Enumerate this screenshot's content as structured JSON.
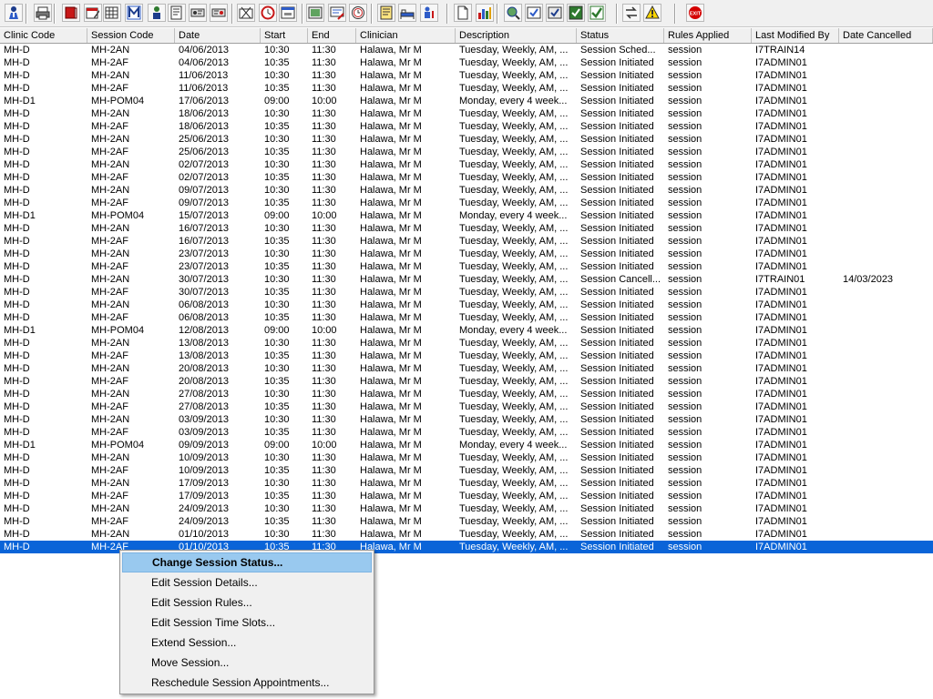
{
  "toolbar": {
    "buttons": [
      {
        "icon": "patient-icon"
      },
      {
        "icon": "printer-icon"
      },
      {
        "icon": "book-red-icon"
      },
      {
        "icon": "calendar-edit-icon"
      },
      {
        "icon": "grid-edit-icon"
      },
      {
        "icon": "m-letter-icon"
      },
      {
        "icon": "person-icon"
      },
      {
        "icon": "notes-icon"
      },
      {
        "icon": "ticket-icon"
      },
      {
        "icon": "ticket-alt-icon"
      },
      {
        "icon": "folder-cut-icon"
      },
      {
        "icon": "clock-icon"
      },
      {
        "icon": "window-icon"
      },
      {
        "icon": "picture-frame-icon"
      },
      {
        "icon": "card-edit-icon"
      },
      {
        "icon": "clock-face-icon"
      },
      {
        "icon": "note-pad-icon"
      },
      {
        "icon": "bed-icon"
      },
      {
        "icon": "person-chart-icon"
      },
      {
        "icon": "page-icon"
      },
      {
        "icon": "bar-chart-icon"
      },
      {
        "icon": "globe-search-icon"
      },
      {
        "icon": "check-window-icon"
      },
      {
        "icon": "check-window-alt-icon"
      },
      {
        "icon": "refresh-check-icon"
      },
      {
        "icon": "check-green-icon"
      },
      {
        "icon": "swap-arrows-icon"
      },
      {
        "icon": "warning-icon"
      },
      {
        "icon": "exit-icon"
      }
    ],
    "exit_label": "EXIT"
  },
  "table": {
    "headers": [
      "Clinic Code",
      "Session Code",
      "Date",
      "Start",
      "End",
      "Clinician",
      "Description",
      "Status",
      "Rules Applied",
      "Last Modified By",
      "Date Cancelled"
    ],
    "rows": [
      [
        "MH-D",
        "MH-2AN",
        "04/06/2013",
        "10:30",
        "11:30",
        "Halawa, Mr M",
        "Tuesday, Weekly, AM, ...",
        "Session Sched...",
        "session",
        "I7TRAIN14",
        ""
      ],
      [
        "MH-D",
        "MH-2AF",
        "04/06/2013",
        "10:35",
        "11:30",
        "Halawa, Mr M",
        "Tuesday, Weekly, AM, ...",
        "Session Initiated",
        "session",
        "I7ADMIN01",
        ""
      ],
      [
        "MH-D",
        "MH-2AN",
        "11/06/2013",
        "10:30",
        "11:30",
        "Halawa, Mr M",
        "Tuesday, Weekly, AM, ...",
        "Session Initiated",
        "session",
        "I7ADMIN01",
        ""
      ],
      [
        "MH-D",
        "MH-2AF",
        "11/06/2013",
        "10:35",
        "11:30",
        "Halawa, Mr M",
        "Tuesday, Weekly, AM, ...",
        "Session Initiated",
        "session",
        "I7ADMIN01",
        ""
      ],
      [
        "MH-D1",
        "MH-POM04",
        "17/06/2013",
        "09:00",
        "10:00",
        "Halawa, Mr M",
        "Monday, every 4 week...",
        "Session Initiated",
        "session",
        "I7ADMIN01",
        ""
      ],
      [
        "MH-D",
        "MH-2AN",
        "18/06/2013",
        "10:30",
        "11:30",
        "Halawa, Mr M",
        "Tuesday, Weekly, AM, ...",
        "Session Initiated",
        "session",
        "I7ADMIN01",
        ""
      ],
      [
        "MH-D",
        "MH-2AF",
        "18/06/2013",
        "10:35",
        "11:30",
        "Halawa, Mr M",
        "Tuesday, Weekly, AM, ...",
        "Session Initiated",
        "session",
        "I7ADMIN01",
        ""
      ],
      [
        "MH-D",
        "MH-2AN",
        "25/06/2013",
        "10:30",
        "11:30",
        "Halawa, Mr M",
        "Tuesday, Weekly, AM, ...",
        "Session Initiated",
        "session",
        "I7ADMIN01",
        ""
      ],
      [
        "MH-D",
        "MH-2AF",
        "25/06/2013",
        "10:35",
        "11:30",
        "Halawa, Mr M",
        "Tuesday, Weekly, AM, ...",
        "Session Initiated",
        "session",
        "I7ADMIN01",
        ""
      ],
      [
        "MH-D",
        "MH-2AN",
        "02/07/2013",
        "10:30",
        "11:30",
        "Halawa, Mr M",
        "Tuesday, Weekly, AM, ...",
        "Session Initiated",
        "session",
        "I7ADMIN01",
        ""
      ],
      [
        "MH-D",
        "MH-2AF",
        "02/07/2013",
        "10:35",
        "11:30",
        "Halawa, Mr M",
        "Tuesday, Weekly, AM, ...",
        "Session Initiated",
        "session",
        "I7ADMIN01",
        ""
      ],
      [
        "MH-D",
        "MH-2AN",
        "09/07/2013",
        "10:30",
        "11:30",
        "Halawa, Mr M",
        "Tuesday, Weekly, AM, ...",
        "Session Initiated",
        "session",
        "I7ADMIN01",
        ""
      ],
      [
        "MH-D",
        "MH-2AF",
        "09/07/2013",
        "10:35",
        "11:30",
        "Halawa, Mr M",
        "Tuesday, Weekly, AM, ...",
        "Session Initiated",
        "session",
        "I7ADMIN01",
        ""
      ],
      [
        "MH-D1",
        "MH-POM04",
        "15/07/2013",
        "09:00",
        "10:00",
        "Halawa, Mr M",
        "Monday, every 4 week...",
        "Session Initiated",
        "session",
        "I7ADMIN01",
        ""
      ],
      [
        "MH-D",
        "MH-2AN",
        "16/07/2013",
        "10:30",
        "11:30",
        "Halawa, Mr M",
        "Tuesday, Weekly, AM, ...",
        "Session Initiated",
        "session",
        "I7ADMIN01",
        ""
      ],
      [
        "MH-D",
        "MH-2AF",
        "16/07/2013",
        "10:35",
        "11:30",
        "Halawa, Mr M",
        "Tuesday, Weekly, AM, ...",
        "Session Initiated",
        "session",
        "I7ADMIN01",
        ""
      ],
      [
        "MH-D",
        "MH-2AN",
        "23/07/2013",
        "10:30",
        "11:30",
        "Halawa, Mr M",
        "Tuesday, Weekly, AM, ...",
        "Session Initiated",
        "session",
        "I7ADMIN01",
        ""
      ],
      [
        "MH-D",
        "MH-2AF",
        "23/07/2013",
        "10:35",
        "11:30",
        "Halawa, Mr M",
        "Tuesday, Weekly, AM, ...",
        "Session Initiated",
        "session",
        "I7ADMIN01",
        ""
      ],
      [
        "MH-D",
        "MH-2AN",
        "30/07/2013",
        "10:30",
        "11:30",
        "Halawa, Mr M",
        "Tuesday, Weekly, AM, ...",
        "Session Cancell...",
        "session",
        "I7TRAIN01",
        "14/03/2023"
      ],
      [
        "MH-D",
        "MH-2AF",
        "30/07/2013",
        "10:35",
        "11:30",
        "Halawa, Mr M",
        "Tuesday, Weekly, AM, ...",
        "Session Initiated",
        "session",
        "I7ADMIN01",
        ""
      ],
      [
        "MH-D",
        "MH-2AN",
        "06/08/2013",
        "10:30",
        "11:30",
        "Halawa, Mr M",
        "Tuesday, Weekly, AM, ...",
        "Session Initiated",
        "session",
        "I7ADMIN01",
        ""
      ],
      [
        "MH-D",
        "MH-2AF",
        "06/08/2013",
        "10:35",
        "11:30",
        "Halawa, Mr M",
        "Tuesday, Weekly, AM, ...",
        "Session Initiated",
        "session",
        "I7ADMIN01",
        ""
      ],
      [
        "MH-D1",
        "MH-POM04",
        "12/08/2013",
        "09:00",
        "10:00",
        "Halawa, Mr M",
        "Monday, every 4 week...",
        "Session Initiated",
        "session",
        "I7ADMIN01",
        ""
      ],
      [
        "MH-D",
        "MH-2AN",
        "13/08/2013",
        "10:30",
        "11:30",
        "Halawa, Mr M",
        "Tuesday, Weekly, AM, ...",
        "Session Initiated",
        "session",
        "I7ADMIN01",
        ""
      ],
      [
        "MH-D",
        "MH-2AF",
        "13/08/2013",
        "10:35",
        "11:30",
        "Halawa, Mr M",
        "Tuesday, Weekly, AM, ...",
        "Session Initiated",
        "session",
        "I7ADMIN01",
        ""
      ],
      [
        "MH-D",
        "MH-2AN",
        "20/08/2013",
        "10:30",
        "11:30",
        "Halawa, Mr M",
        "Tuesday, Weekly, AM, ...",
        "Session Initiated",
        "session",
        "I7ADMIN01",
        ""
      ],
      [
        "MH-D",
        "MH-2AF",
        "20/08/2013",
        "10:35",
        "11:30",
        "Halawa, Mr M",
        "Tuesday, Weekly, AM, ...",
        "Session Initiated",
        "session",
        "I7ADMIN01",
        ""
      ],
      [
        "MH-D",
        "MH-2AN",
        "27/08/2013",
        "10:30",
        "11:30",
        "Halawa, Mr M",
        "Tuesday, Weekly, AM, ...",
        "Session Initiated",
        "session",
        "I7ADMIN01",
        ""
      ],
      [
        "MH-D",
        "MH-2AF",
        "27/08/2013",
        "10:35",
        "11:30",
        "Halawa, Mr M",
        "Tuesday, Weekly, AM, ...",
        "Session Initiated",
        "session",
        "I7ADMIN01",
        ""
      ],
      [
        "MH-D",
        "MH-2AN",
        "03/09/2013",
        "10:30",
        "11:30",
        "Halawa, Mr M",
        "Tuesday, Weekly, AM, ...",
        "Session Initiated",
        "session",
        "I7ADMIN01",
        ""
      ],
      [
        "MH-D",
        "MH-2AF",
        "03/09/2013",
        "10:35",
        "11:30",
        "Halawa, Mr M",
        "Tuesday, Weekly, AM, ...",
        "Session Initiated",
        "session",
        "I7ADMIN01",
        ""
      ],
      [
        "MH-D1",
        "MH-POM04",
        "09/09/2013",
        "09:00",
        "10:00",
        "Halawa, Mr M",
        "Monday, every 4 week...",
        "Session Initiated",
        "session",
        "I7ADMIN01",
        ""
      ],
      [
        "MH-D",
        "MH-2AN",
        "10/09/2013",
        "10:30",
        "11:30",
        "Halawa, Mr M",
        "Tuesday, Weekly, AM, ...",
        "Session Initiated",
        "session",
        "I7ADMIN01",
        ""
      ],
      [
        "MH-D",
        "MH-2AF",
        "10/09/2013",
        "10:35",
        "11:30",
        "Halawa, Mr M",
        "Tuesday, Weekly, AM, ...",
        "Session Initiated",
        "session",
        "I7ADMIN01",
        ""
      ],
      [
        "MH-D",
        "MH-2AN",
        "17/09/2013",
        "10:30",
        "11:30",
        "Halawa, Mr M",
        "Tuesday, Weekly, AM, ...",
        "Session Initiated",
        "session",
        "I7ADMIN01",
        ""
      ],
      [
        "MH-D",
        "MH-2AF",
        "17/09/2013",
        "10:35",
        "11:30",
        "Halawa, Mr M",
        "Tuesday, Weekly, AM, ...",
        "Session Initiated",
        "session",
        "I7ADMIN01",
        ""
      ],
      [
        "MH-D",
        "MH-2AN",
        "24/09/2013",
        "10:30",
        "11:30",
        "Halawa, Mr M",
        "Tuesday, Weekly, AM, ...",
        "Session Initiated",
        "session",
        "I7ADMIN01",
        ""
      ],
      [
        "MH-D",
        "MH-2AF",
        "24/09/2013",
        "10:35",
        "11:30",
        "Halawa, Mr M",
        "Tuesday, Weekly, AM, ...",
        "Session Initiated",
        "session",
        "I7ADMIN01",
        ""
      ],
      [
        "MH-D",
        "MH-2AN",
        "01/10/2013",
        "10:30",
        "11:30",
        "Halawa, Mr M",
        "Tuesday, Weekly, AM, ...",
        "Session Initiated",
        "session",
        "I7ADMIN01",
        ""
      ],
      [
        "MH-D",
        "MH-2AF",
        "01/10/2013",
        "10:35",
        "11:30",
        "Halawa, Mr M",
        "Tuesday, Weekly, AM, ...",
        "Session Initiated",
        "session",
        "I7ADMIN01",
        ""
      ]
    ],
    "selected_row": 39
  },
  "context_menu": {
    "items": [
      {
        "label": "Change Session Status...",
        "active": true
      },
      {
        "label": "Edit Session Details...",
        "active": false
      },
      {
        "label": "Edit Session Rules...",
        "active": false
      },
      {
        "label": "Edit Session Time Slots...",
        "active": false
      },
      {
        "label": "Extend Session...",
        "active": false
      },
      {
        "label": "Move Session...",
        "active": false
      },
      {
        "label": "Reschedule Session Appointments...",
        "active": false
      }
    ]
  },
  "colors": {
    "selection": "#0a64d8",
    "menu_highlight": "#99c9ef",
    "toolbar_bg": "#f0f0f0",
    "exit_red": "#d40000"
  }
}
